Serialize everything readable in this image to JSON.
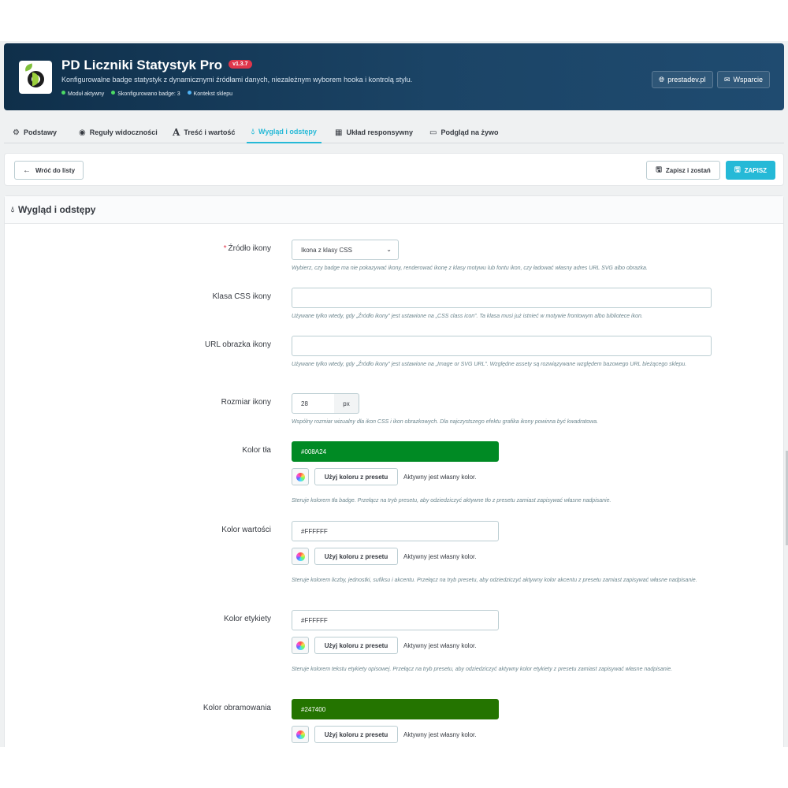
{
  "header": {
    "title": "PD Liczniki Statystyk Pro",
    "version": "v1.3.7",
    "description": "Konfigurowalne badge statystyk z dynamicznymi źródłami danych, niezależnym wyborem hooka i kontrolą stylu.",
    "stats": [
      {
        "label": "Moduł aktywny",
        "color": "#4cd964"
      },
      {
        "label": "Skonfigurowano badge: 3",
        "color": "#4cd964"
      },
      {
        "label": "Kontekst sklepu",
        "color": "#4fb3f6"
      }
    ],
    "links": [
      {
        "label": "prestadev.pl",
        "icon": "globe-icon"
      },
      {
        "label": "Wsparcie",
        "icon": "envelope-icon"
      }
    ]
  },
  "tabs": [
    {
      "label": "Podstawy",
      "icon": "cogs-icon"
    },
    {
      "label": "Reguły widoczności",
      "icon": "eye-icon"
    },
    {
      "label": "Treść i wartość",
      "icon": "font-icon"
    },
    {
      "label": "Wygląd i odstępy",
      "icon": "tint-icon",
      "active": true
    },
    {
      "label": "Układ responsywny",
      "icon": "grid-icon"
    },
    {
      "label": "Podgląd na żywo",
      "icon": "monitor-icon"
    }
  ],
  "toolbar": {
    "back_label": "Wróć do listy",
    "save_stay_label": "Zapisz i zostań",
    "save_label": "ZAPISZ"
  },
  "panel": {
    "title": "Wygląd i odstępy"
  },
  "fields": {
    "icon_source": {
      "label": "Źródło ikony",
      "required": true,
      "value": "Ikona z klasy CSS",
      "help": "Wybierz, czy badge ma nie pokazywać ikony, renderować ikonę z klasy motywu lub fontu ikon, czy ładować własny adres URL SVG albo obrazka."
    },
    "css_class": {
      "label": "Klasa CSS ikony",
      "value": "",
      "help": "Używane tylko wtedy, gdy „Źródło ikony” jest ustawione na „CSS class icon”. Ta klasa musi już istnieć w motywie frontowym albo bibliotece ikon."
    },
    "image_url": {
      "label": "URL obrazka ikony",
      "value": "",
      "help": "Używane tylko wtedy, gdy „Źródło ikony” jest ustawione na „Image or SVG URL”. Względne assety są rozwiązywane względem bazowego URL bieżącego sklepu."
    },
    "icon_size": {
      "label": "Rozmiar ikony",
      "value": "28",
      "unit": "px",
      "help": "Wspólny rozmiar wizualny dla ikon CSS i ikon obrazkowych. Dla najczystszego efektu grafika ikony powinna być kwadratowa."
    },
    "bg_color": {
      "label": "Kolor tła",
      "value": "#008A24",
      "preset_label": "Użyj koloru z presetu",
      "active_text": "Aktywny jest własny kolor.",
      "help": "Steruje kolorem tła badge. Przełącz na tryb presetu, aby odziedziczyć aktywne tło z presetu zamiast zapisywać własne nadpisanie."
    },
    "value_color": {
      "label": "Kolor wartości",
      "value": "#FFFFFF",
      "preset_label": "Użyj koloru z presetu",
      "active_text": "Aktywny jest własny kolor.",
      "help": "Steruje kolorem liczby, jednostki, sufiksu i akcentu. Przełącz na tryb presetu, aby odziedziczyć aktywny kolor akcentu z presetu zamiast zapisywać własne nadpisanie."
    },
    "label_color": {
      "label": "Kolor etykiety",
      "value": "#FFFFFF",
      "preset_label": "Użyj koloru z presetu",
      "active_text": "Aktywny jest własny kolor.",
      "help": "Steruje kolorem tekstu etykiety opisowej. Przełącz na tryb presetu, aby odziedziczyć aktywny kolor etykiety z presetu zamiast zapisywać własne nadpisanie."
    },
    "border_color": {
      "label": "Kolor obramowania",
      "value": "#247400",
      "preset_label": "Użyj koloru z presetu",
      "active_text": "Aktywny jest własny kolor."
    }
  },
  "colors": {
    "accent": "#25b9d7",
    "danger": "#e0364b",
    "header_bg": "#163a5a"
  }
}
